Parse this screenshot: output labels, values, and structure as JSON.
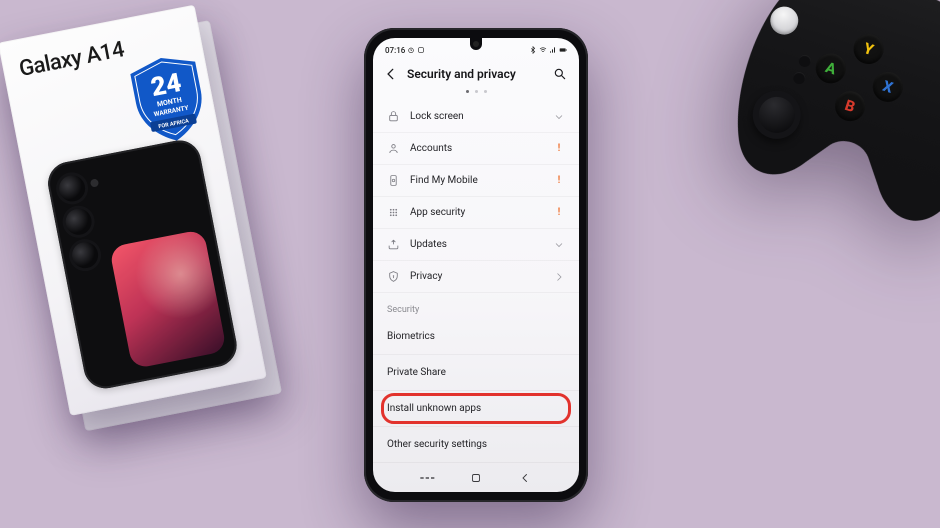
{
  "box": {
    "title": "Galaxy A14",
    "badge_number": "24",
    "badge_line1": "MONTH",
    "badge_line2": "WARRANTY",
    "badge_ribbon": "FOR AFRICA"
  },
  "status": {
    "time": "07:16",
    "battery_pct": "100"
  },
  "header": {
    "title": "Security and privacy"
  },
  "rows": [
    {
      "icon": "lock",
      "label": "Lock screen",
      "tail": "chevron-down"
    },
    {
      "icon": "person",
      "label": "Accounts",
      "tail": "warn"
    },
    {
      "icon": "find",
      "label": "Find My Mobile",
      "tail": "warn"
    },
    {
      "icon": "grid",
      "label": "App security",
      "tail": "warn"
    },
    {
      "icon": "updates",
      "label": "Updates",
      "tail": "chevron-down"
    },
    {
      "icon": "privacy",
      "label": "Privacy",
      "tail": "chevron-right"
    }
  ],
  "section_label": "Security",
  "plain_rows": [
    {
      "label": "Biometrics",
      "highlight": false
    },
    {
      "label": "Private Share",
      "highlight": false
    },
    {
      "label": "Install unknown apps",
      "highlight": true
    },
    {
      "label": "Other security settings",
      "highlight": false
    }
  ],
  "controller": {
    "Y": "Y",
    "X": "X",
    "A": "A",
    "B": "B"
  }
}
